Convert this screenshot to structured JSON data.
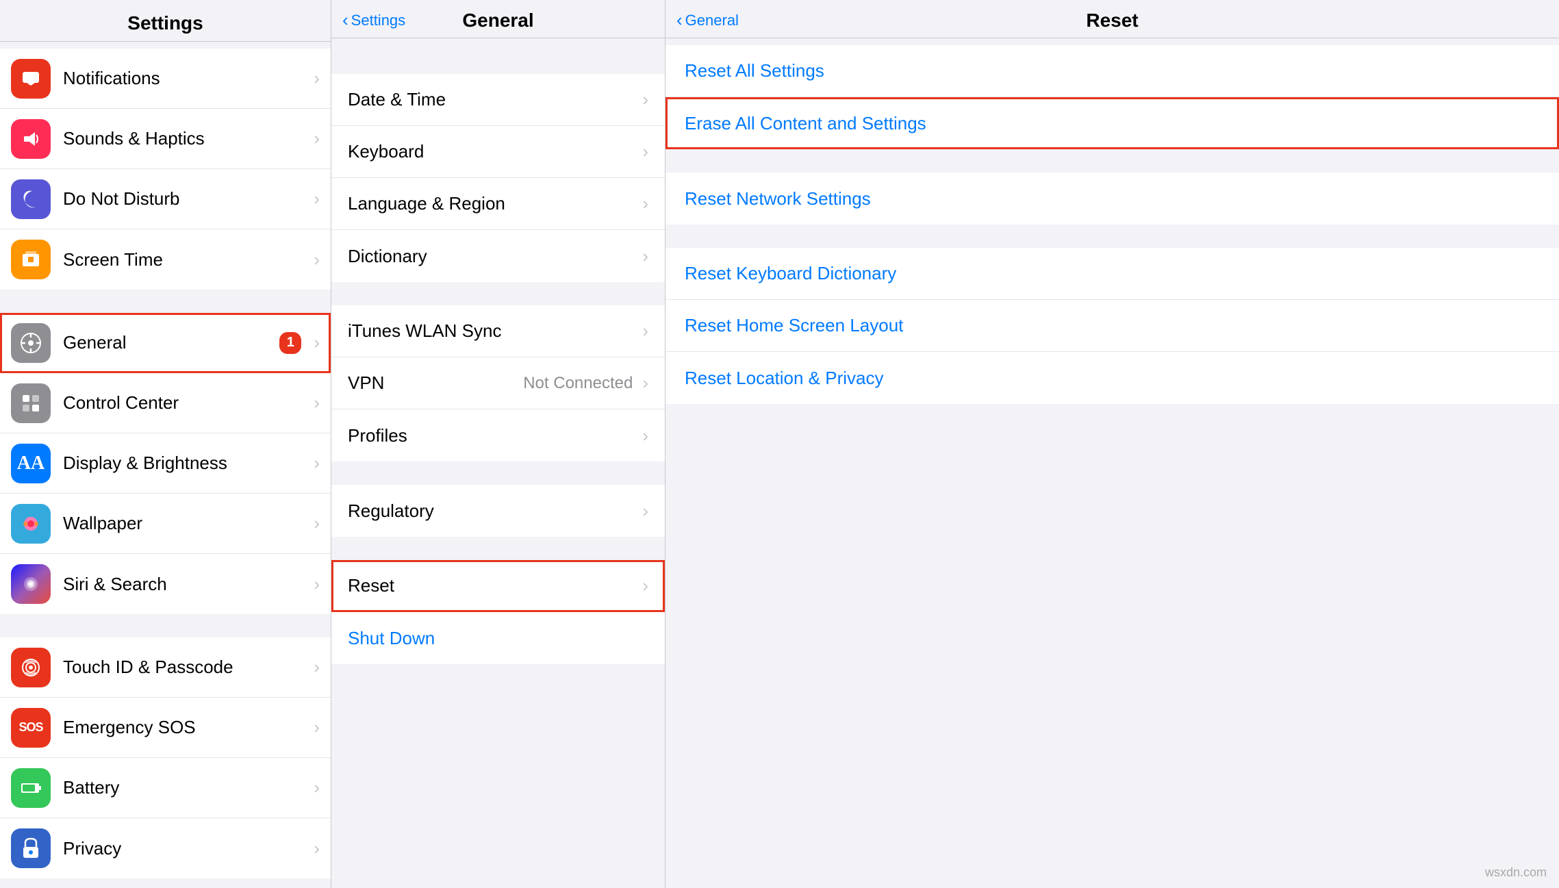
{
  "settings": {
    "title": "Settings",
    "items": [
      {
        "id": "notifications",
        "label": "Notifications",
        "icon_char": "🔔",
        "icon_class": "ic-red",
        "highlighted": false
      },
      {
        "id": "sounds",
        "label": "Sounds & Haptics",
        "icon_char": "🔊",
        "icon_class": "ic-pink",
        "highlighted": false
      },
      {
        "id": "donotdisturb",
        "label": "Do Not Disturb",
        "icon_char": "🌙",
        "icon_class": "ic-purple",
        "highlighted": false
      },
      {
        "id": "screentime",
        "label": "Screen Time",
        "icon_char": "⏳",
        "icon_class": "ic-orange",
        "highlighted": false
      },
      {
        "id": "general",
        "label": "General",
        "icon_char": "⚙️",
        "icon_class": "ic-gray",
        "badge": "1",
        "highlighted": true
      },
      {
        "id": "controlcenter",
        "label": "Control Center",
        "icon_char": "⊞",
        "icon_class": "ic-gray",
        "highlighted": false
      },
      {
        "id": "displaybrightness",
        "label": "Display & Brightness",
        "icon_char": "AA",
        "icon_class": "ic-blue",
        "highlighted": false
      },
      {
        "id": "wallpaper",
        "label": "Wallpaper",
        "icon_char": "🌸",
        "icon_class": "ic-teal",
        "highlighted": false
      },
      {
        "id": "sirisearch",
        "label": "Siri & Search",
        "icon_char": "◉",
        "icon_class": "ic-gradient-siri",
        "highlighted": false
      },
      {
        "id": "touchid",
        "label": "Touch ID & Passcode",
        "icon_char": "◎",
        "icon_class": "ic-red",
        "highlighted": false
      },
      {
        "id": "emergencysos",
        "label": "Emergency SOS",
        "icon_char": "SOS",
        "icon_class": "ic-red",
        "highlighted": false
      },
      {
        "id": "battery",
        "label": "Battery",
        "icon_char": "🔋",
        "icon_class": "ic-green",
        "highlighted": false
      },
      {
        "id": "privacy",
        "label": "Privacy",
        "icon_char": "✋",
        "icon_class": "ic-blue",
        "highlighted": false
      }
    ]
  },
  "general": {
    "back_label": "Settings",
    "title": "General",
    "items": [
      {
        "id": "datetime",
        "label": "Date & Time",
        "highlighted": false
      },
      {
        "id": "keyboard",
        "label": "Keyboard",
        "highlighted": false
      },
      {
        "id": "language",
        "label": "Language & Region",
        "highlighted": false
      },
      {
        "id": "dictionary",
        "label": "Dictionary",
        "highlighted": false
      },
      {
        "id": "ituneswlan",
        "label": "iTunes WLAN Sync",
        "highlighted": false
      },
      {
        "id": "vpn",
        "label": "VPN",
        "value": "Not Connected",
        "highlighted": false
      },
      {
        "id": "profiles",
        "label": "Profiles",
        "highlighted": false
      },
      {
        "id": "regulatory",
        "label": "Regulatory",
        "highlighted": false
      },
      {
        "id": "reset",
        "label": "Reset",
        "highlighted": true
      },
      {
        "id": "shutdown",
        "label": "Shut Down",
        "is_blue": true,
        "highlighted": false
      }
    ]
  },
  "reset": {
    "back_label": "General",
    "title": "Reset",
    "items": [
      {
        "id": "reset-all-settings",
        "label": "Reset All Settings",
        "highlighted": false
      },
      {
        "id": "erase-all",
        "label": "Erase All Content and Settings",
        "highlighted": true
      },
      {
        "id": "reset-network",
        "label": "Reset Network Settings",
        "highlighted": false
      },
      {
        "id": "reset-keyboard",
        "label": "Reset Keyboard Dictionary",
        "highlighted": false
      },
      {
        "id": "reset-home",
        "label": "Reset Home Screen Layout",
        "highlighted": false
      },
      {
        "id": "reset-location",
        "label": "Reset Location & Privacy",
        "highlighted": false
      }
    ]
  },
  "watermark": "wsxdn.com"
}
